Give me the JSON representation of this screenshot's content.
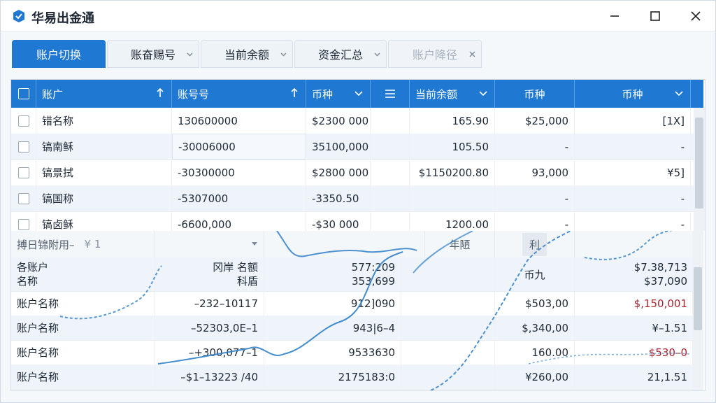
{
  "app": {
    "title": "华易出金通"
  },
  "tabs": [
    {
      "label": "账户切换",
      "active": true
    },
    {
      "label": "账奋赐号"
    },
    {
      "label": "当前余额"
    },
    {
      "label": "资金汇总"
    },
    {
      "label": "账户降径",
      "disabled": true
    }
  ],
  "grid": {
    "headers": [
      "账广",
      "账号号",
      "币种",
      "当前余额",
      "币种",
      "币种"
    ],
    "rows": [
      {
        "name": "错名称",
        "acct": "130600000",
        "amount": "$2300 000",
        "balance": "165.90",
        "cur1": "$25,000",
        "cur2": "[1X]"
      },
      {
        "name": "镐南稣",
        "acct": "-30006000",
        "amount": "35100,000",
        "balance": "105.50",
        "cur1": "-",
        "cur2": "-"
      },
      {
        "name": "镐景拭",
        "acct": "-30300000",
        "amount": "$2800 000",
        "balance": "$1150200.80",
        "cur1": "93,000",
        "cur2": "¥5]"
      },
      {
        "name": "镐国称",
        "acct": "-5307000",
        "amount": "-3350.50",
        "balance": "",
        "cur1": "-",
        "cur2": "-"
      },
      {
        "name": "镐卤稣",
        "acct": "-6600,000",
        "amount": "-$30 000",
        "balance": "1200.00",
        "cur1": "-",
        "cur2": "-"
      }
    ]
  },
  "lower": {
    "filter_label": "搏日锦附用–",
    "filter_value": "¥ 1",
    "col_a": "年陋",
    "col_b": "利",
    "rows": [
      {
        "name": "各账户\n名称",
        "v1": "冈岸 名额\n科盾",
        "v2": "577:209\n353,699",
        "v3": "币九",
        "v4": "$7.38,713\n$37,090",
        "red": false
      },
      {
        "name": "账户名称",
        "v1": "–232–10117",
        "v2": "912]090",
        "v3": "$503,00",
        "v4": "$,150,001",
        "red": true
      },
      {
        "name": "账户名称",
        "v1": "–52303,0E–1",
        "v2": "943|6–4",
        "v3": "$,340,00",
        "v4": "¥–1.51",
        "red": false
      },
      {
        "name": "账户名称",
        "v1": "–+300,077–1",
        "v2": "9533630",
        "v3": "160.00",
        "v4": "$530–0",
        "red": true
      },
      {
        "name": "账户名称",
        "v1": "–$1–13223 /40",
        "v2": "2175183:0",
        "v3": "¥260,00",
        "v4": "21,1.51",
        "red": false
      }
    ]
  },
  "colors": {
    "accent": "#1f78d1",
    "negative": "#a8252e"
  },
  "icons": [
    "app-logo-icon",
    "minimize-icon",
    "maximize-icon",
    "close-icon",
    "sort-up-icon",
    "filter-dropdown-icon",
    "menu-icon",
    "pin-icon"
  ]
}
